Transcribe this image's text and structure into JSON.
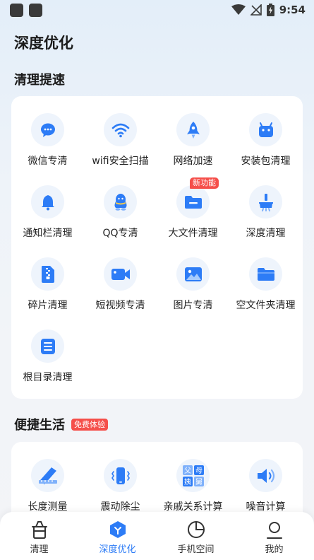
{
  "status_bar": {
    "time": "9:54"
  },
  "header": {
    "title": "深度优化"
  },
  "sections": {
    "cleanup": {
      "title": "清理提速",
      "items": [
        {
          "label": "微信专清",
          "icon": "wechat-icon"
        },
        {
          "label": "wifi安全扫描",
          "icon": "wifi-icon"
        },
        {
          "label": "网络加速",
          "icon": "rocket-icon"
        },
        {
          "label": "安装包清理",
          "icon": "android-icon"
        },
        {
          "label": "通知栏清理",
          "icon": "bell-icon"
        },
        {
          "label": "QQ专清",
          "icon": "qq-icon"
        },
        {
          "label": "大文件清理",
          "icon": "folder-icon",
          "badge": "新功能"
        },
        {
          "label": "深度清理",
          "icon": "broom-icon"
        },
        {
          "label": "碎片清理",
          "icon": "zip-file-icon"
        },
        {
          "label": "短视频专清",
          "icon": "video-icon"
        },
        {
          "label": "图片专清",
          "icon": "image-icon"
        },
        {
          "label": "空文件夹清理",
          "icon": "empty-folder-icon"
        },
        {
          "label": "根目录清理",
          "icon": "root-list-icon"
        }
      ]
    },
    "life": {
      "title": "便捷生活",
      "badge": "免费体验",
      "items": [
        {
          "label": "长度测量",
          "icon": "ruler-icon"
        },
        {
          "label": "震动除尘",
          "icon": "vibrate-phone-icon"
        },
        {
          "label": "亲戚关系计算",
          "icon": "relative-calc-icon"
        },
        {
          "label": "噪音计算",
          "icon": "speaker-icon"
        }
      ]
    }
  },
  "relative_icon_chars": [
    "父",
    "母",
    "姨",
    "舅"
  ],
  "bottom_nav": {
    "items": [
      {
        "label": "清理",
        "icon": "trash-icon",
        "active": false
      },
      {
        "label": "深度优化",
        "icon": "optimize-icon",
        "active": true
      },
      {
        "label": "手机空间",
        "icon": "pie-clock-icon",
        "active": false
      },
      {
        "label": "我的",
        "icon": "user-icon",
        "active": false
      }
    ]
  },
  "colors": {
    "accent": "#2d7cf6",
    "icon_bg": "#eef4fc",
    "badge": "#f54f4a"
  }
}
